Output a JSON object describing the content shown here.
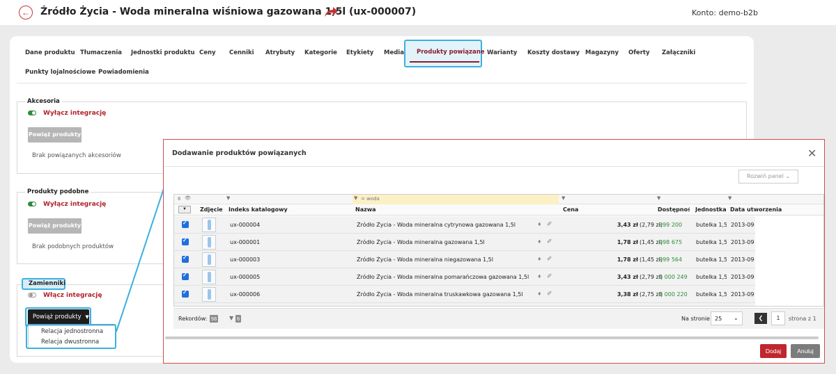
{
  "header": {
    "title": "Źródło Życia - Woda mineralna wiśniowa gazowana 1,5l (ux-000007)",
    "account": "Konto: demo-b2b"
  },
  "tabs": [
    "Dane produktu",
    "Tłumaczenia",
    "Jednostki produktu",
    "Ceny",
    "Cenniki",
    "Atrybuty",
    "Kategorie",
    "Etykiety",
    "Media",
    "Produkty powiązane",
    "Warianty",
    "Koszty dostawy",
    "Magazyny",
    "Oferty",
    "Załączniki",
    "Punkty lojalnościowe",
    "Powiadomienia"
  ],
  "sections": {
    "accessories": {
      "legend": "Akcesoria",
      "toggle_label": "Wyłącz integrację",
      "button": "Powiąż produkty",
      "empty": "Brak powiązanych akcesoriów"
    },
    "similar": {
      "legend": "Produkty podobne",
      "toggle_label": "Wyłącz integrację",
      "button": "Powiąż produkty",
      "empty": "Brak podobnych produktów"
    },
    "substitutes": {
      "legend": "Zamienniki",
      "toggle_label": "Włącz integrację",
      "button": "Powiąż produkty",
      "menu": [
        "Relacja jednostronna",
        "Relacja dwustronna"
      ]
    }
  },
  "modal": {
    "title": "Dodawanie produktów powiązanych",
    "expand_panel": "Rozwiń panel",
    "column_count": "6",
    "name_filter": "= woda",
    "columns": [
      "Zdjęcie",
      "Indeks katalogowy",
      "Nazwa",
      "Cena",
      "Dostępność",
      "Jednostka",
      "Data utworzenia"
    ],
    "rows": [
      {
        "index": "ux-000004",
        "name": "Źródło Życia - Woda mineralna cytrynowa gazowana 1,5l",
        "price": "3,43 zł",
        "net": "(2,79 zł)",
        "stock": "999 200",
        "unit": "butelka 1,5l",
        "date": "2013-09-"
      },
      {
        "index": "ux-000001",
        "name": "Źródło Życia - Woda mineralna gazowana 1,5l",
        "price": "1,78 zł",
        "net": "(1,45 zł)",
        "stock": "998 675",
        "unit": "butelka 1,5l",
        "date": "2013-09-"
      },
      {
        "index": "ux-000003",
        "name": "Źródło Życia - Woda mineralna niegazowana 1,5l",
        "price": "1,78 zł",
        "net": "(1,45 zł)",
        "stock": "999 564",
        "unit": "butelka 1,5l",
        "date": "2013-09-"
      },
      {
        "index": "ux-000005",
        "name": "Źródło Życia - Woda mineralna pomarańczowa gazowana 1,5l",
        "price": "3,43 zł",
        "net": "(2,79 zł)",
        "stock": "1 000 249",
        "unit": "butelka 1,5l",
        "date": "2013-09-"
      },
      {
        "index": "ux-000006",
        "name": "Źródło Życia - Woda mineralna truskawkowa gazowana 1,5l",
        "price": "3,38 zł",
        "net": "(2,75 zł)",
        "stock": "1 000 220",
        "unit": "butelka 1,5l",
        "date": "2013-09-"
      }
    ],
    "footer": {
      "records_label": "Rekordów:",
      "records": "56",
      "filtered": "6",
      "per_page_label": "Na stronie",
      "per_page": "25",
      "page": "1",
      "page_of": "strona z 1"
    },
    "add": "Dodaj",
    "cancel": "Anuluj"
  },
  "colors": {
    "accent": "#8a1c2a",
    "callout": "#3bb0e0",
    "primary_button": "#c0262e",
    "stock_green": "#2e8b3b"
  }
}
